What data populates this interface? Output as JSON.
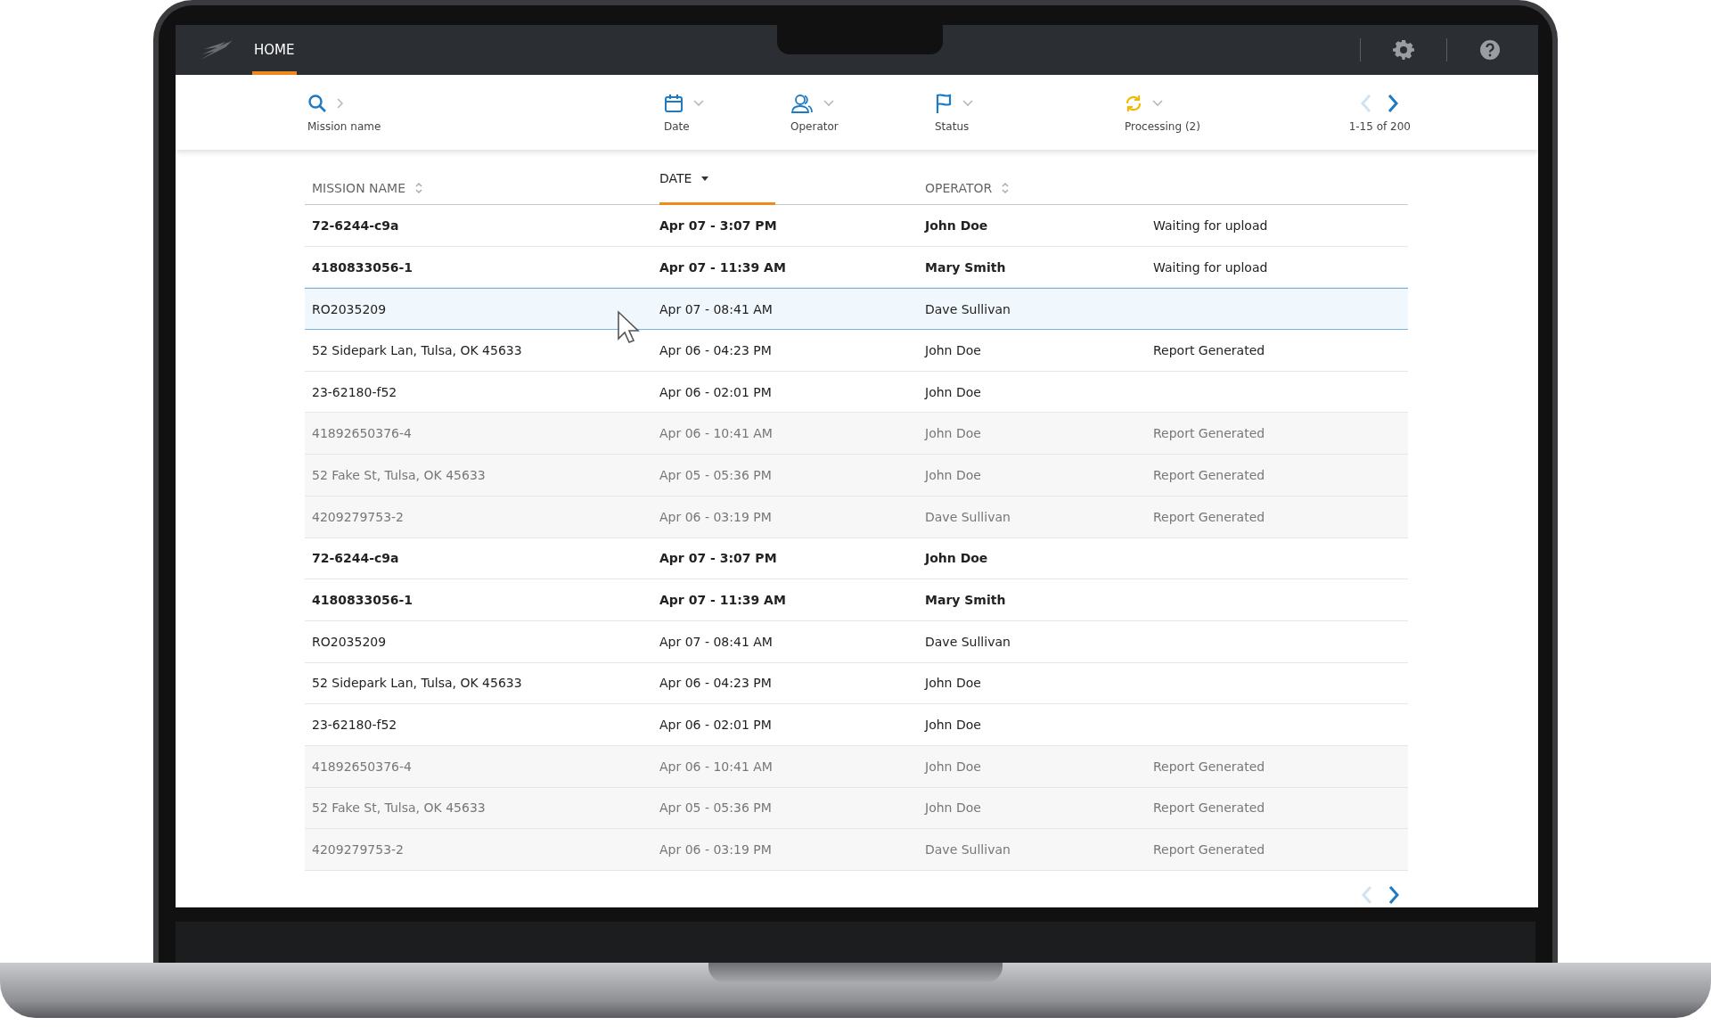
{
  "top_bar": {
    "nav_tabs": [
      {
        "label": "HOME",
        "selected": true
      }
    ]
  },
  "filters": [
    {
      "kind": "search",
      "label": "Mission name"
    },
    {
      "kind": "date",
      "label": "Date"
    },
    {
      "kind": "operator",
      "label": "Operator"
    },
    {
      "kind": "status",
      "label": "Status"
    },
    {
      "kind": "processing",
      "label": "Processing (2)"
    }
  ],
  "pager": {
    "range": "1-15 of 200"
  },
  "table": {
    "columns": [
      {
        "label": "MISSION NAME",
        "selected": false
      },
      {
        "label": "DATE",
        "selected": true
      },
      {
        "label": "OPERATOR",
        "selected": false
      }
    ],
    "rows": [
      {
        "mission": "72-6244-c9a",
        "date": "Apr 07 - 3:07 PM",
        "operator": "John Doe",
        "status": "Waiting for upload",
        "unread": true,
        "selected": false,
        "archived": false
      },
      {
        "mission": "4180833056-1",
        "date": "Apr 07 - 11:39 AM",
        "operator": "Mary Smith",
        "status": "Waiting for upload",
        "unread": true,
        "selected": false,
        "archived": false
      },
      {
        "mission": "RO2035209",
        "date": "Apr 07 - 08:41 AM",
        "operator": "Dave Sullivan",
        "unread": false,
        "selected": true,
        "archived": false
      },
      {
        "mission": "52 Sidepark Lan, Tulsa, OK 45633",
        "date": "Apr 06 - 04:23 PM",
        "operator": "John Doe",
        "status": "Report Generated",
        "unread": false,
        "selected": false,
        "archived": false
      },
      {
        "mission": "23-62180-f52",
        "date": "Apr 06 - 02:01 PM",
        "operator": "John Doe",
        "unread": false,
        "selected": false,
        "archived": false
      },
      {
        "mission": "41892650376-4",
        "date": "Apr 06 - 10:41 AM",
        "operator": "John Doe",
        "status": "Report Generated",
        "unread": false,
        "selected": false,
        "archived": true
      },
      {
        "mission": "52 Fake St, Tulsa, OK 45633",
        "date": "Apr 05 - 05:36 PM",
        "operator": "John Doe",
        "status": "Report Generated",
        "unread": false,
        "selected": false,
        "archived": true
      },
      {
        "mission": "4209279753-2",
        "date": "Apr 06 - 03:19 PM",
        "operator": "Dave Sullivan",
        "status": "Report Generated",
        "unread": false,
        "selected": false,
        "archived": true
      },
      {
        "mission": "72-6244-c9a",
        "date": "Apr 07 - 3:07 PM",
        "operator": "John Doe",
        "unread": true,
        "selected": false,
        "archived": false
      },
      {
        "mission": "4180833056-1",
        "date": "Apr 07 - 11:39 AM",
        "operator": "Mary Smith",
        "unread": true,
        "selected": false,
        "archived": false
      },
      {
        "mission": "RO2035209",
        "date": "Apr 07 - 08:41 AM",
        "operator": "Dave Sullivan",
        "unread": false,
        "selected": false,
        "archived": false
      },
      {
        "mission": "52 Sidepark Lan, Tulsa, OK 45633",
        "date": "Apr 06 - 04:23 PM",
        "operator": "John Doe",
        "unread": false,
        "selected": false,
        "archived": false
      },
      {
        "mission": "23-62180-f52",
        "date": "Apr 06 - 02:01 PM",
        "operator": "John Doe",
        "unread": false,
        "selected": false,
        "archived": false
      },
      {
        "mission": "41892650376-4",
        "date": "Apr 06 - 10:41 AM",
        "operator": "John Doe",
        "status": "Report Generated",
        "unread": false,
        "selected": false,
        "archived": true
      },
      {
        "mission": "52 Fake St, Tulsa, OK 45633",
        "date": "Apr 05 - 05:36 PM",
        "operator": "John Doe",
        "status": "Report Generated",
        "unread": false,
        "selected": false,
        "archived": true
      },
      {
        "mission": "4209279753-2",
        "date": "Apr 06 - 03:19 PM",
        "operator": "Dave Sullivan",
        "status": "Report Generated",
        "unread": false,
        "selected": false,
        "archived": true
      }
    ]
  }
}
